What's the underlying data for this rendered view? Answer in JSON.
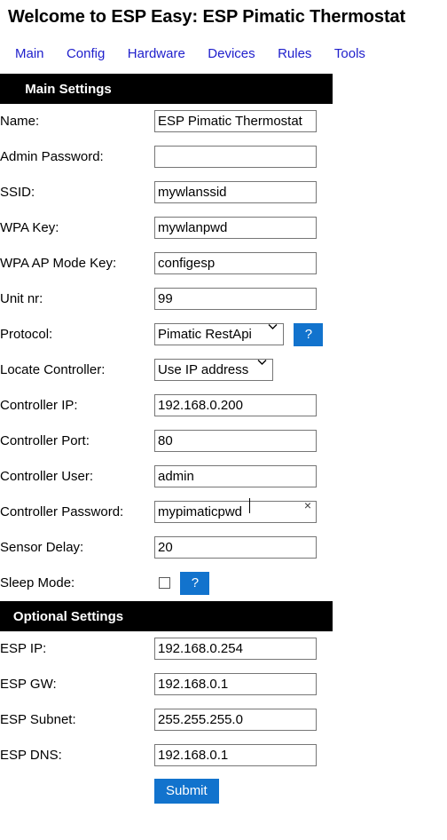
{
  "page": {
    "title": "Welcome to ESP Easy: ESP Pimatic Thermostat"
  },
  "nav": {
    "items": [
      {
        "label": "Main"
      },
      {
        "label": "Config"
      },
      {
        "label": "Hardware"
      },
      {
        "label": "Devices"
      },
      {
        "label": "Rules"
      },
      {
        "label": "Tools"
      }
    ]
  },
  "colors": {
    "accent_blue": "#1273cd",
    "link_blue": "#2020cc",
    "header_black": "#000000",
    "input_border": "#767676"
  },
  "main_settings": {
    "section_title": "Main Settings",
    "fields": {
      "name": {
        "label": "Name:",
        "value": "ESP Pimatic Thermostat",
        "placeholder": ""
      },
      "admin_password": {
        "label": "Admin Password:",
        "value": "",
        "placeholder": ""
      },
      "ssid": {
        "label": "SSID:",
        "value": "mywlanssid",
        "placeholder": ""
      },
      "wpa_key": {
        "label": "WPA Key:",
        "value": "mywlanpwd",
        "placeholder": ""
      },
      "wpa_ap_mode_key": {
        "label": "WPA AP Mode Key:",
        "value": "configesp",
        "placeholder": ""
      },
      "unit_nr": {
        "label": "Unit nr:",
        "value": "99",
        "placeholder": ""
      },
      "protocol": {
        "label": "Protocol:",
        "value": "Pimatic RestApi",
        "options": [
          "Pimatic RestApi"
        ],
        "help_label": "?"
      },
      "locate_controller": {
        "label": "Locate Controller:",
        "value": "Use IP address",
        "options": [
          "Use IP address"
        ]
      },
      "controller_ip": {
        "label": "Controller IP:",
        "value": "192.168.0.200",
        "placeholder": ""
      },
      "controller_port": {
        "label": "Controller Port:",
        "value": "80",
        "placeholder": ""
      },
      "controller_user": {
        "label": "Controller User:",
        "value": "admin",
        "placeholder": ""
      },
      "controller_password": {
        "label": "Controller Password:",
        "value": "mypimaticpwd",
        "placeholder": "",
        "clear_label": "×"
      },
      "sensor_delay": {
        "label": "Sensor Delay:",
        "value": "20",
        "placeholder": ""
      },
      "sleep_mode": {
        "label": "Sleep Mode:",
        "checked": false,
        "help_label": "?"
      }
    }
  },
  "optional_settings": {
    "section_title": "Optional Settings",
    "fields": {
      "esp_ip": {
        "label": "ESP IP:",
        "value": "192.168.0.254",
        "placeholder": ""
      },
      "esp_gw": {
        "label": "ESP GW:",
        "value": "192.168.0.1",
        "placeholder": ""
      },
      "esp_subnet": {
        "label": "ESP Subnet:",
        "value": "255.255.255.0",
        "placeholder": ""
      },
      "esp_dns": {
        "label": "ESP DNS:",
        "value": "192.168.0.1",
        "placeholder": ""
      }
    }
  },
  "actions": {
    "submit_label": "Submit"
  },
  "icons": {
    "chevron_down": "⌄",
    "question_mark": "?",
    "clear_x": "×"
  }
}
